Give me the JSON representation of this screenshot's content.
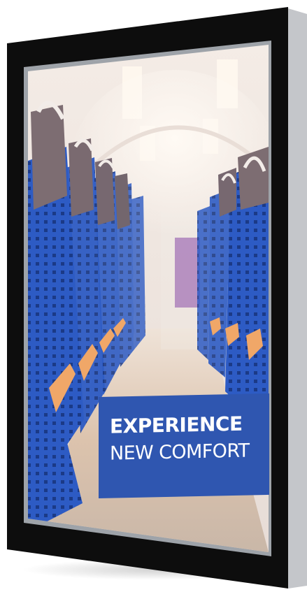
{
  "poster": {
    "headline_line1": "EXPERIENCE",
    "headline_line2": "NEW COMFORT"
  },
  "colors": {
    "frame": "#0d0d0d",
    "frame_edge": "#c9cbcf",
    "seat_blue": "#2d5bc4",
    "banner_blue": "#2f56b0",
    "armrest_orange": "#f0a768"
  }
}
